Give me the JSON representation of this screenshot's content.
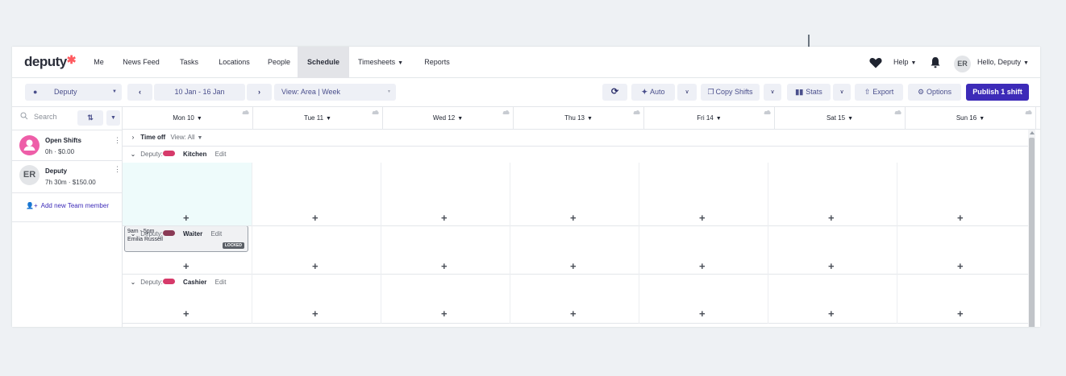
{
  "nav": {
    "logo": "deputy",
    "items": [
      {
        "label": "Me"
      },
      {
        "label": "News Feed"
      },
      {
        "label": "Tasks"
      },
      {
        "label": "Locations"
      },
      {
        "label": "People"
      },
      {
        "label": "Schedule",
        "active": true
      },
      {
        "label": "Timesheets",
        "dropdown": true
      },
      {
        "label": "Reports"
      }
    ],
    "help_label": "Help",
    "avatar_initials": "ER",
    "greeting": "Hello, Deputy"
  },
  "toolbar": {
    "location": "Deputy",
    "date_range": "10 Jan - 16 Jan",
    "view": "View: Area |  Week",
    "auto_label": "Auto",
    "copy_label": "Copy Shifts",
    "stats_label": "Stats",
    "export_label": "Export",
    "options_label": "Options",
    "publish_label": "Publish 1 shift",
    "accent_color": "#3d2bb8"
  },
  "sidebar": {
    "search_placeholder": "Search",
    "members": [
      {
        "initials": "",
        "name": "Open Shifts",
        "sub": "0h · $0.00",
        "avatar_color": "#ee5ea8"
      },
      {
        "initials": "ER",
        "name": "Deputy",
        "sub": "7h 30m · $150.00",
        "avatar_color": "#e3e5e8"
      }
    ],
    "add_member_label": "Add new Team member"
  },
  "days": [
    {
      "label": "Mon 10"
    },
    {
      "label": "Tue 11"
    },
    {
      "label": "Wed 12"
    },
    {
      "label": "Thu 13"
    },
    {
      "label": "Fri 14"
    },
    {
      "label": "Sat 15"
    },
    {
      "label": "Sun 16"
    }
  ],
  "time_off": {
    "label": "Time off",
    "view": "View: All"
  },
  "areas": [
    {
      "prefix": "Deputy:",
      "name": "Kitchen",
      "edit": "Edit",
      "color": "#d63a6a"
    },
    {
      "prefix": "Deputy:",
      "name": "Waiter",
      "edit": "Edit",
      "color": "#8a3a55"
    },
    {
      "prefix": "Deputy:",
      "name": "Cashier",
      "edit": "Edit",
      "color": "#d63a6a"
    }
  ],
  "shift": {
    "time": "9am - 5pm",
    "employee": "Emilia Russell",
    "status": "LOCKED"
  }
}
